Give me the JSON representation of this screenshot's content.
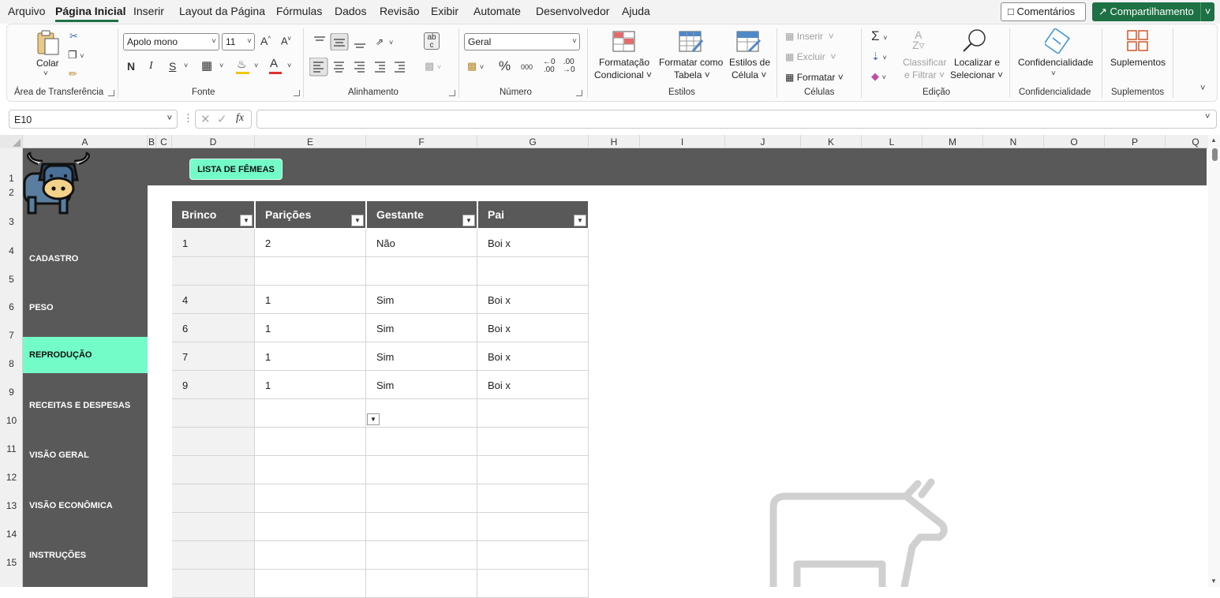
{
  "menu": {
    "items": [
      "Arquivo",
      "Página Inicial",
      "Inserir",
      "Layout da Página",
      "Fórmulas",
      "Dados",
      "Revisão",
      "Exibir",
      "Automate",
      "Desenvolvedor",
      "Ajuda"
    ],
    "comments_label": "Comentários",
    "share_label": "Compartilhamento"
  },
  "ribbon": {
    "clipboard": {
      "paste_label": "Colar",
      "group_label": "Área de Transferência"
    },
    "font": {
      "font_name": "Apolo mono",
      "font_size": "11",
      "bold": "N",
      "italic": "I",
      "underline": "S",
      "group_label": "Fonte"
    },
    "alignment": {
      "group_label": "Alinhamento"
    },
    "number": {
      "format": "Geral",
      "percent": "%",
      "thousands": "000",
      "group_label": "Número"
    },
    "styles": {
      "cond_format_l1": "Formatação",
      "cond_format_l2": "Condicional",
      "format_table_l1": "Formatar como",
      "format_table_l2": "Tabela",
      "cell_styles_l1": "Estilos de",
      "cell_styles_l2": "Célula",
      "group_label": "Estilos"
    },
    "cells": {
      "insert": "Inserir",
      "delete": "Excluir",
      "format": "Formatar",
      "group_label": "Células"
    },
    "editing": {
      "sort_l1": "Classificar",
      "sort_l2": "e Filtrar",
      "find_l1": "Localizar e",
      "find_l2": "Selecionar",
      "group_label": "Edição"
    },
    "sensitivity": {
      "label": "Confidencialidade",
      "group_label": "Confidencialidade"
    },
    "addins": {
      "label": "Suplementos",
      "group_label": "Suplementos"
    }
  },
  "formula_bar": {
    "name_box": "E10",
    "fx": "fx",
    "formula": ""
  },
  "columns": [
    "A",
    "B",
    "C",
    "D",
    "E",
    "F",
    "G",
    "H",
    "I",
    "J",
    "K",
    "L",
    "M",
    "N",
    "O",
    "P",
    "Q"
  ],
  "rows": [
    "1",
    "2",
    "3",
    "4",
    "5",
    "6",
    "7",
    "8",
    "9",
    "10",
    "11",
    "12",
    "13",
    "14",
    "15"
  ],
  "banner": {
    "button_label": "LISTA DE FÊMEAS"
  },
  "sidebar": {
    "items": [
      {
        "label": "CADASTRO"
      },
      {
        "label": "PESO"
      },
      {
        "label": "REPRODUÇÃO"
      },
      {
        "label": "RECEITAS E DESPESAS"
      },
      {
        "label": "VISÃO GERAL"
      },
      {
        "label": "VISÃO ECONÔMICA"
      },
      {
        "label": "INSTRUÇÕES"
      }
    ],
    "active": "REPRODUÇÃO"
  },
  "table": {
    "headers": [
      "Brinco",
      "Parições",
      "Gestante",
      "Pai"
    ],
    "rows": [
      [
        "1",
        "2",
        "Não",
        "Boi x"
      ],
      [
        "",
        "",
        "",
        ""
      ],
      [
        "4",
        "1",
        "Sim",
        "Boi x"
      ],
      [
        "6",
        "1",
        "Sim",
        "Boi x"
      ],
      [
        "7",
        "1",
        "Sim",
        "Boi x"
      ],
      [
        "9",
        "1",
        "Sim",
        "Boi x"
      ],
      [
        "",
        "",
        "",
        ""
      ],
      [
        "",
        "",
        "",
        ""
      ],
      [
        "",
        "",
        "",
        ""
      ],
      [
        "",
        "",
        "",
        ""
      ],
      [
        "",
        "",
        "",
        ""
      ],
      [
        "",
        "",
        "",
        ""
      ],
      [
        "",
        "",
        "",
        ""
      ]
    ]
  },
  "colors": {
    "accent_green": "#1e7145",
    "mint": "#73fbc8",
    "dark_gray": "#595959"
  }
}
